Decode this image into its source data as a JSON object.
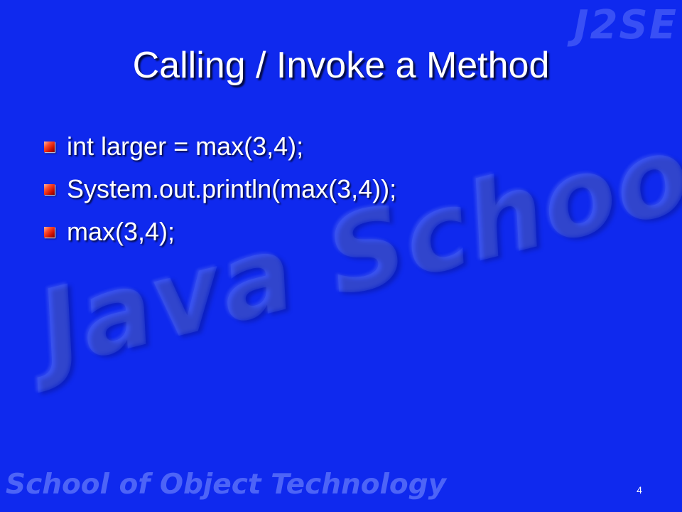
{
  "slide": {
    "title": "Calling / Invoke a Method",
    "bullets": [
      "int larger = max(3,4);",
      "System.out.println(max(3,4));",
      "max(3,4);"
    ],
    "page_number": "4",
    "watermarks": {
      "main": "Java School",
      "corner": "J2SE",
      "footer": "School of Object Technology"
    },
    "colors": {
      "background": "#0f29ee",
      "text": "#ffffff",
      "bullet": "#e01a00"
    }
  }
}
